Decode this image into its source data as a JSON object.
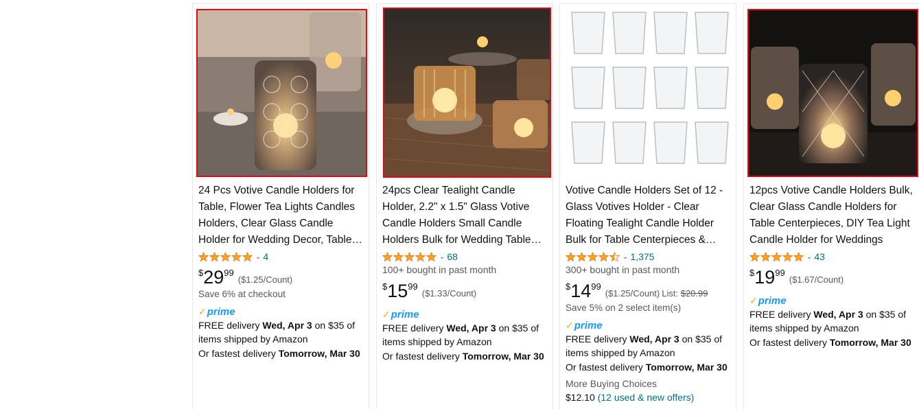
{
  "colors": {
    "link": "#007185",
    "star": "#ffa41c",
    "prime": "#1399ff",
    "selection": "#e30613"
  },
  "products": [
    {
      "title": "24 Pcs Votive Candle Holders for Table, Flower Tea Lights Candles Holders, Clear Glass Candle Holder for Wedding Decor, Table Centerpieces",
      "rating": 5,
      "rating_count": "4",
      "bought": "",
      "price_currency": "$",
      "price_whole": "29",
      "price_fraction": "99",
      "unit_price": "($1.25/Count)",
      "list_label": "",
      "list_price": "",
      "savings": "Save 6% at checkout",
      "prime_check": "✓",
      "prime_word": "prime",
      "delivery_prefix": "FREE delivery ",
      "delivery_date": "Wed, Apr 3",
      "delivery_suffix": " on $35 of items shipped by Amazon",
      "fastest_prefix": "Or fastest delivery ",
      "fastest_date": "Tomorrow, Mar 30",
      "more_label": "",
      "more_price": "",
      "more_offers": ""
    },
    {
      "title": "24pcs Clear Tealight Candle Holder, 2.2\" x 1.5\" Glass Votive Candle Holders Small Candle Holders Bulk for Wedding Table Centerpieces",
      "rating": 5,
      "rating_count": "68",
      "bought": "100+ bought in past month",
      "price_currency": "$",
      "price_whole": "15",
      "price_fraction": "99",
      "unit_price": "($1.33/Count)",
      "list_label": "",
      "list_price": "",
      "savings": "",
      "prime_check": "✓",
      "prime_word": "prime",
      "delivery_prefix": "FREE delivery ",
      "delivery_date": "Wed, Apr 3",
      "delivery_suffix": " on $35 of items shipped by Amazon",
      "fastest_prefix": "Or fastest delivery ",
      "fastest_date": "Tomorrow, Mar 30",
      "more_label": "",
      "more_price": "",
      "more_offers": ""
    },
    {
      "title": "Votive Candle Holders Set of 12 - Glass Votives Holder - Clear Floating Tealight Candle Holder Bulk for Table Centerpieces & Home Decor",
      "rating": 4.5,
      "rating_count": "1,375",
      "bought": "300+ bought in past month",
      "price_currency": "$",
      "price_whole": "14",
      "price_fraction": "99",
      "unit_price": "($1.25/Count)",
      "list_label": "List:",
      "list_price": "$20.99",
      "savings": "Save 5% on 2 select item(s)",
      "prime_check": "✓",
      "prime_word": "prime",
      "delivery_prefix": "FREE delivery ",
      "delivery_date": "Wed, Apr 3",
      "delivery_suffix": " on $35 of items shipped by Amazon",
      "fastest_prefix": "Or fastest delivery ",
      "fastest_date": "Tomorrow, Mar 30",
      "more_label": "More Buying Choices",
      "more_price": "$12.10",
      "more_offers": "(12 used & new offers)"
    },
    {
      "title": "12pcs Votive Candle Holders Bulk, Clear Glass Candle Holders for Table Centerpieces, DIY Tea Light Candle Holder for Weddings",
      "rating": 5,
      "rating_count": "43",
      "bought": "",
      "price_currency": "$",
      "price_whole": "19",
      "price_fraction": "99",
      "unit_price": "($1.67/Count)",
      "list_label": "",
      "list_price": "",
      "savings": "",
      "prime_check": "✓",
      "prime_word": "prime",
      "delivery_prefix": "FREE delivery ",
      "delivery_date": "Wed, Apr 3",
      "delivery_suffix": " on $35 of items shipped by Amazon",
      "fastest_prefix": "Or fastest delivery ",
      "fastest_date": "Tomorrow, Mar 30",
      "more_label": "",
      "more_price": "",
      "more_offers": ""
    }
  ]
}
